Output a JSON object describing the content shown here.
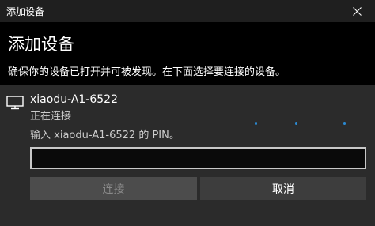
{
  "window": {
    "title": "添加设备"
  },
  "dialog": {
    "heading": "添加设备",
    "subtitle": "确保你的设备已打开并可被发现。在下面选择要连接的设备。"
  },
  "device": {
    "icon": "monitor-icon",
    "name": "xiaodu-A1-6522",
    "status": "正在连接",
    "pin_prompt": "输入 xiaodu-A1-6522 的 PIN。",
    "pin_value": ""
  },
  "buttons": {
    "connect_label": "连接",
    "cancel_label": "取消"
  },
  "colors": {
    "progress_dot": "#2a8ad4"
  }
}
